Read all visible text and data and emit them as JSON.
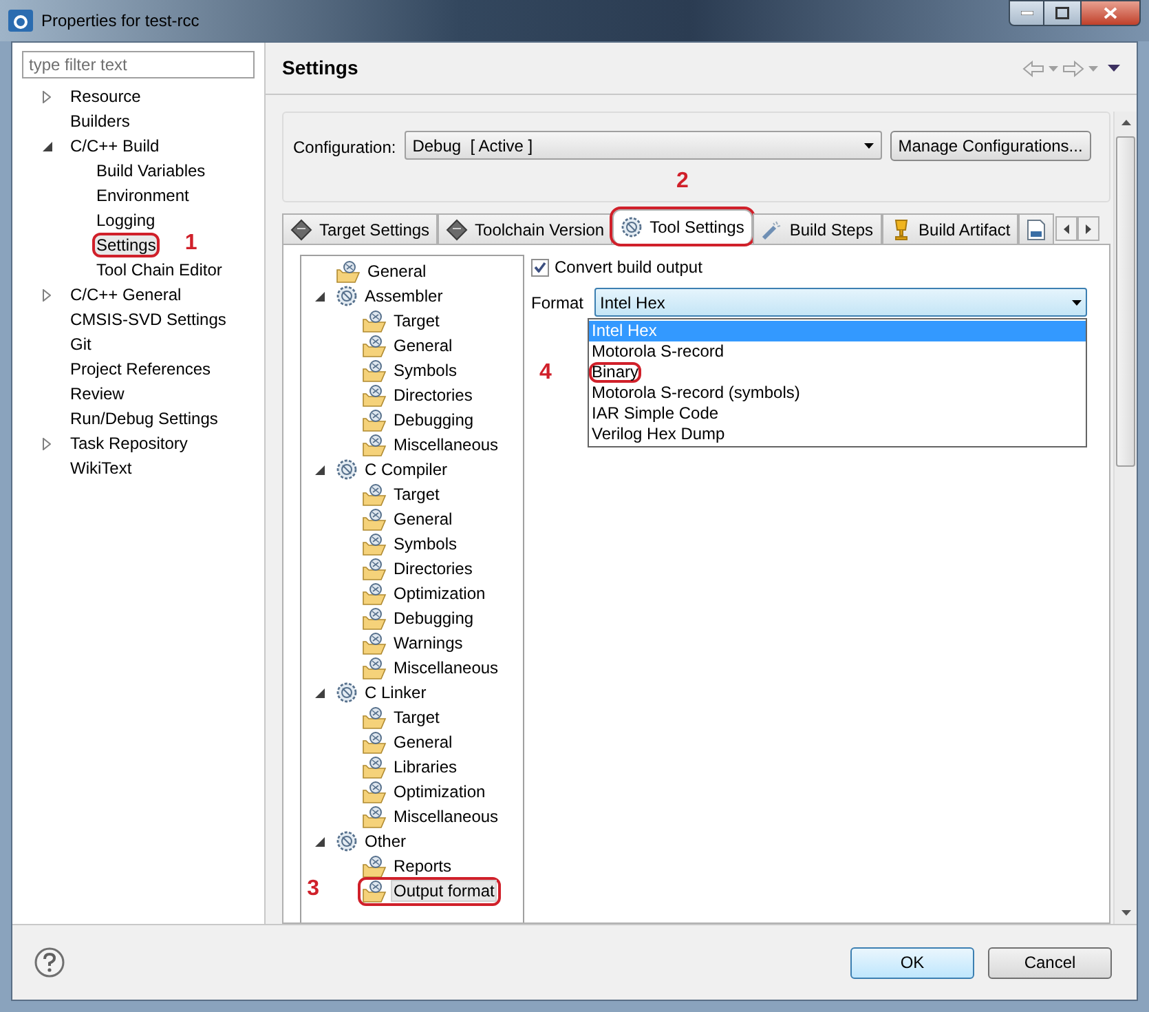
{
  "window": {
    "title": "Properties for test-rcc"
  },
  "filter": {
    "placeholder": "type filter text"
  },
  "nav_tree": [
    {
      "label": "Resource",
      "expanded": false,
      "selected": false
    },
    {
      "label": "Builders",
      "selected": false
    },
    {
      "label": "C/C++ Build",
      "expanded": true,
      "selected": false,
      "children": [
        {
          "label": "Build Variables",
          "selected": false
        },
        {
          "label": "Environment",
          "selected": false
        },
        {
          "label": "Logging",
          "selected": false
        },
        {
          "label": "Settings",
          "selected": true,
          "circled": true,
          "callout": "1"
        },
        {
          "label": "Tool Chain Editor",
          "selected": false
        }
      ]
    },
    {
      "label": "C/C++ General",
      "expanded": false,
      "selected": false
    },
    {
      "label": "CMSIS-SVD Settings",
      "selected": false
    },
    {
      "label": "Git",
      "selected": false
    },
    {
      "label": "Project References",
      "selected": false
    },
    {
      "label": "Review",
      "selected": false
    },
    {
      "label": "Run/Debug Settings",
      "selected": false
    },
    {
      "label": "Task Repository",
      "expanded": false,
      "selected": false
    },
    {
      "label": "WikiText",
      "selected": false
    }
  ],
  "page": {
    "title": "Settings"
  },
  "configuration": {
    "label": "Configuration:",
    "value": "Debug  [ Active ]",
    "manage_button": "Manage Configurations..."
  },
  "tabs": [
    {
      "label": "Target Settings",
      "kind": "chip",
      "selected": false
    },
    {
      "label": "Toolchain Version",
      "kind": "chip",
      "selected": false
    },
    {
      "label": "Tool Settings",
      "kind": "gear",
      "selected": true,
      "circled": true,
      "callout": "2"
    },
    {
      "label": "Build Steps",
      "kind": "wand",
      "selected": false
    },
    {
      "label": "Build Artifact",
      "kind": "trophy",
      "selected": false
    },
    {
      "kind": "document",
      "selected": false
    }
  ],
  "tool_tree": [
    {
      "label": "General",
      "selected": false
    },
    {
      "label": "Assembler",
      "expanded": true,
      "selected": false,
      "children": [
        {
          "label": "Target",
          "selected": false
        },
        {
          "label": "General",
          "selected": false
        },
        {
          "label": "Symbols",
          "selected": false
        },
        {
          "label": "Directories",
          "selected": false
        },
        {
          "label": "Debugging",
          "selected": false
        },
        {
          "label": "Miscellaneous",
          "selected": false
        }
      ]
    },
    {
      "label": "C Compiler",
      "expanded": true,
      "selected": false,
      "children": [
        {
          "label": "Target",
          "selected": false
        },
        {
          "label": "General",
          "selected": false
        },
        {
          "label": "Symbols",
          "selected": false
        },
        {
          "label": "Directories",
          "selected": false
        },
        {
          "label": "Optimization",
          "selected": false
        },
        {
          "label": "Debugging",
          "selected": false
        },
        {
          "label": "Warnings",
          "selected": false
        },
        {
          "label": "Miscellaneous",
          "selected": false
        }
      ]
    },
    {
      "label": "C Linker",
      "expanded": true,
      "selected": false,
      "children": [
        {
          "label": "Target",
          "selected": false
        },
        {
          "label": "General",
          "selected": false
        },
        {
          "label": "Libraries",
          "selected": false
        },
        {
          "label": "Optimization",
          "selected": false
        },
        {
          "label": "Miscellaneous",
          "selected": false
        }
      ]
    },
    {
      "label": "Other",
      "expanded": true,
      "selected": false,
      "children": [
        {
          "label": "Reports",
          "selected": false
        },
        {
          "label": "Output format",
          "selected": true,
          "circled": true,
          "callout": "3"
        }
      ]
    }
  ],
  "convert_output": {
    "label": "Convert build output",
    "checked": true
  },
  "format": {
    "label": "Format",
    "value": "Intel Hex",
    "open": true,
    "options": [
      {
        "label": "Intel Hex",
        "selected": true
      },
      {
        "label": "Motorola S-record",
        "selected": false
      },
      {
        "label": "Binary",
        "selected": false,
        "circled": true,
        "callout": "4"
      },
      {
        "label": "Motorola S-record (symbols)",
        "selected": false
      },
      {
        "label": "IAR Simple Code",
        "selected": false
      },
      {
        "label": "Verilog Hex Dump",
        "selected": false
      }
    ]
  },
  "buttons": [
    {
      "label": "OK",
      "default": true
    },
    {
      "label": "Cancel",
      "default": false
    }
  ]
}
